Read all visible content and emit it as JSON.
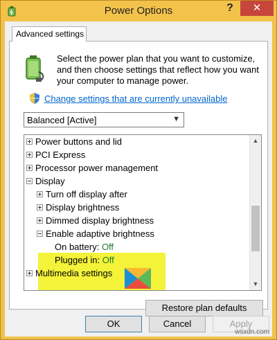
{
  "window": {
    "title": "Power Options",
    "help_glyph": "?",
    "close_glyph": "✕"
  },
  "tab": {
    "label": "Advanced settings"
  },
  "intro": {
    "description": "Select the power plan that you want to customize, and then choose settings that reflect how you want your computer to manage power.",
    "change_link": "Change settings that are currently unavailable"
  },
  "plan_select": {
    "value": "Balanced [Active]"
  },
  "tree": {
    "items": [
      {
        "label": "Power buttons and lid",
        "expander": "plus",
        "level": 0
      },
      {
        "label": "PCI Express",
        "expander": "plus",
        "level": 0
      },
      {
        "label": "Processor power management",
        "expander": "plus",
        "level": 0
      },
      {
        "label": "Display",
        "expander": "minus",
        "level": 0
      },
      {
        "label": "Turn off display after",
        "expander": "plus",
        "level": 1
      },
      {
        "label": "Display brightness",
        "expander": "plus",
        "level": 1
      },
      {
        "label": "Dimmed display brightness",
        "expander": "plus",
        "level": 1
      },
      {
        "label": "Enable adaptive brightness",
        "expander": "minus",
        "level": 1
      },
      {
        "label": "Multimedia settings",
        "expander": "plus",
        "level": 0
      }
    ],
    "on_battery": {
      "label": "On battery:",
      "value": "Off"
    },
    "plugged_in": {
      "label": "Plugged in:",
      "value": "Off"
    }
  },
  "buttons": {
    "restore": "Restore plan defaults",
    "ok": "OK",
    "cancel": "Cancel",
    "apply": "Apply"
  },
  "watermark": "wsxdn.com",
  "colors": {
    "titlebar": "#f3c24b",
    "close": "#c7463b",
    "link": "#0066cc",
    "highlight": "#f4f33a",
    "value_green": "#1e7c2a"
  }
}
